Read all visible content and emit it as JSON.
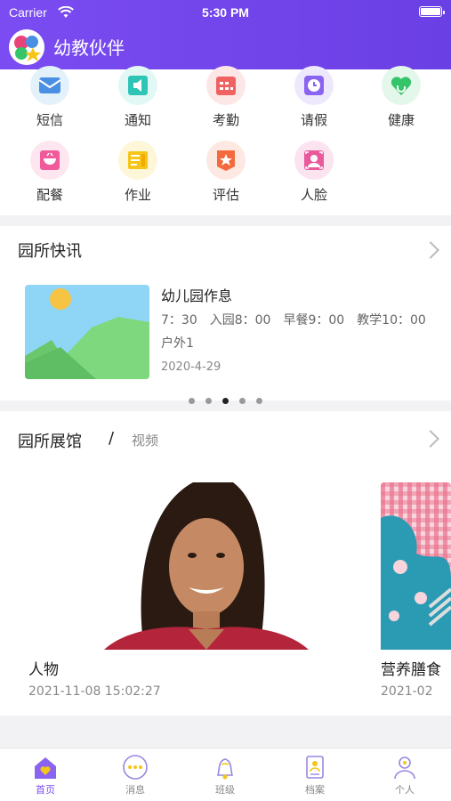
{
  "status_bar": {
    "carrier": "Carrier",
    "time": "5:30 PM"
  },
  "app": {
    "title": "幼教伙伴"
  },
  "features": [
    {
      "label": "短信",
      "icon": "sms-icon",
      "color": "#4a90e2",
      "bg": "#e3f1fb"
    },
    {
      "label": "通知",
      "icon": "notice-icon",
      "color": "#2ec4b6",
      "bg": "#e2f8f5"
    },
    {
      "label": "考勤",
      "icon": "attendance-icon",
      "color": "#f06262",
      "bg": "#fde6e6"
    },
    {
      "label": "请假",
      "icon": "leave-icon",
      "color": "#8a63f0",
      "bg": "#eee8fd"
    },
    {
      "label": "健康",
      "icon": "health-icon",
      "color": "#34c46a",
      "bg": "#e4f7eb"
    },
    {
      "label": "配餐",
      "icon": "meal-icon",
      "color": "#f05a9a",
      "bg": "#fde6f0"
    },
    {
      "label": "作业",
      "icon": "homework-icon",
      "color": "#f5c518",
      "bg": "#fdf6d9"
    },
    {
      "label": "评估",
      "icon": "evaluate-icon",
      "color": "#f26a3d",
      "bg": "#fde9e1"
    },
    {
      "label": "人脸",
      "icon": "face-icon",
      "color": "#e85a9c",
      "bg": "#fbe3ef"
    }
  ],
  "news": {
    "section_title": "园所快讯",
    "item": {
      "title": "幼儿园作息",
      "body": "7：30　入园8：00　早餐9：00　教学10：00　户外1",
      "date": "2020-4-29"
    },
    "dot_count": 5,
    "active_dot": 2
  },
  "gallery": {
    "section_title": "园所展馆",
    "divider": "/",
    "subtitle": "视频",
    "items": [
      {
        "name": "人物",
        "time": "2021-11-08 15:02:27"
      },
      {
        "name": "营养膳食",
        "time": "2021-02"
      }
    ]
  },
  "tabbar": {
    "tabs": [
      {
        "label": "首页",
        "icon": "home-icon",
        "active": true
      },
      {
        "label": "消息",
        "icon": "message-icon",
        "active": false
      },
      {
        "label": "班级",
        "icon": "class-bell-icon",
        "active": false
      },
      {
        "label": "档案",
        "icon": "profile-file-icon",
        "active": false
      },
      {
        "label": "个人",
        "icon": "person-icon",
        "active": false
      }
    ]
  },
  "colors": {
    "accent": "#7a4cf2",
    "header_gradient_start": "#7a4cf2",
    "header_gradient_end": "#6a3fe4"
  }
}
